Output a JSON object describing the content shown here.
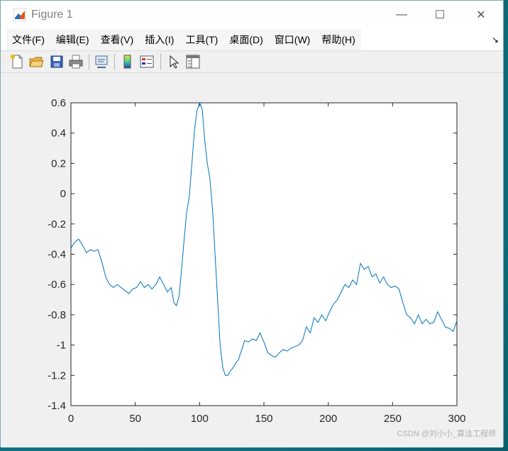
{
  "window": {
    "title": "Figure 1",
    "controls": {
      "minimize": "—",
      "maximize": "☐",
      "close": "✕"
    }
  },
  "menu": {
    "items": [
      {
        "label": "文件(F)"
      },
      {
        "label": "编辑(E)"
      },
      {
        "label": "查看(V)"
      },
      {
        "label": "插入(I)"
      },
      {
        "label": "工具(T)"
      },
      {
        "label": "桌面(D)"
      },
      {
        "label": "窗口(W)"
      },
      {
        "label": "帮助(H)"
      }
    ],
    "dock_arrow": "↘"
  },
  "toolbar": {
    "buttons": [
      "new-figure-icon",
      "open-file-icon",
      "save-icon",
      "print-icon",
      "link-plot-icon",
      "colorbar-icon",
      "legend-icon",
      "pointer-icon",
      "property-inspector-icon"
    ]
  },
  "watermark": "CSDN @刘小小_算法工程师",
  "chart_data": {
    "type": "line",
    "title": "",
    "xlabel": "",
    "ylabel": "",
    "xlim": [
      0,
      300
    ],
    "ylim": [
      -1.4,
      0.6
    ],
    "xticks": [
      0,
      50,
      100,
      150,
      200,
      250,
      300
    ],
    "yticks": [
      0.6,
      0.4,
      0.2,
      0,
      -0.2,
      -0.4,
      -0.6,
      -0.8,
      -1,
      -1.2,
      -1.4
    ],
    "ytick_labels": [
      "0.6",
      "0.4",
      "0.2",
      "0",
      "-0.2",
      "-0.4",
      "-0.6",
      "-0.8",
      "-1",
      "-1.2",
      "-1.4"
    ],
    "grid": false,
    "line_color": "#0072bd",
    "series": [
      {
        "x": [
          0,
          3,
          6,
          9,
          12,
          15,
          18,
          21,
          24,
          27,
          30,
          33,
          36,
          39,
          42,
          45,
          48,
          51,
          54,
          57,
          60,
          63,
          66,
          69,
          72,
          75,
          78,
          80,
          82,
          84,
          86,
          88,
          90,
          92,
          94,
          96,
          98,
          100,
          102,
          104,
          106,
          108,
          110,
          112,
          114,
          116,
          118,
          120,
          122,
          124,
          126,
          128,
          130,
          132,
          135,
          138,
          141,
          144,
          147,
          150,
          153,
          156,
          159,
          162,
          165,
          168,
          171,
          174,
          177,
          180,
          183,
          186,
          189,
          192,
          195,
          198,
          201,
          204,
          207,
          210,
          213,
          216,
          219,
          222,
          225,
          228,
          231,
          234,
          237,
          240,
          243,
          246,
          249,
          252,
          255,
          258,
          261,
          264,
          267,
          270,
          273,
          276,
          279,
          282,
          285,
          288,
          291,
          294,
          297,
          300
        ],
        "y": [
          -0.36,
          -0.32,
          -0.3,
          -0.34,
          -0.39,
          -0.37,
          -0.38,
          -0.37,
          -0.45,
          -0.55,
          -0.6,
          -0.62,
          -0.6,
          -0.62,
          -0.64,
          -0.66,
          -0.63,
          -0.62,
          -0.58,
          -0.62,
          -0.6,
          -0.63,
          -0.6,
          -0.55,
          -0.6,
          -0.65,
          -0.62,
          -0.72,
          -0.74,
          -0.68,
          -0.5,
          -0.3,
          -0.12,
          -0.02,
          0.2,
          0.42,
          0.55,
          0.6,
          0.56,
          0.35,
          0.2,
          0.1,
          -0.1,
          -0.4,
          -0.7,
          -1.0,
          -1.15,
          -1.2,
          -1.2,
          -1.17,
          -1.15,
          -1.12,
          -1.1,
          -1.05,
          -0.97,
          -0.98,
          -0.96,
          -0.97,
          -0.92,
          -0.98,
          -1.05,
          -1.07,
          -1.08,
          -1.05,
          -1.03,
          -1.04,
          -1.02,
          -1.01,
          -1.0,
          -0.97,
          -0.88,
          -0.92,
          -0.82,
          -0.85,
          -0.8,
          -0.84,
          -0.78,
          -0.73,
          -0.7,
          -0.65,
          -0.6,
          -0.62,
          -0.57,
          -0.6,
          -0.46,
          -0.5,
          -0.48,
          -0.55,
          -0.53,
          -0.59,
          -0.55,
          -0.6,
          -0.62,
          -0.61,
          -0.63,
          -0.72,
          -0.8,
          -0.82,
          -0.86,
          -0.8,
          -0.86,
          -0.83,
          -0.86,
          -0.85,
          -0.78,
          -0.83,
          -0.88,
          -0.89,
          -0.91,
          -0.84
        ]
      }
    ]
  }
}
